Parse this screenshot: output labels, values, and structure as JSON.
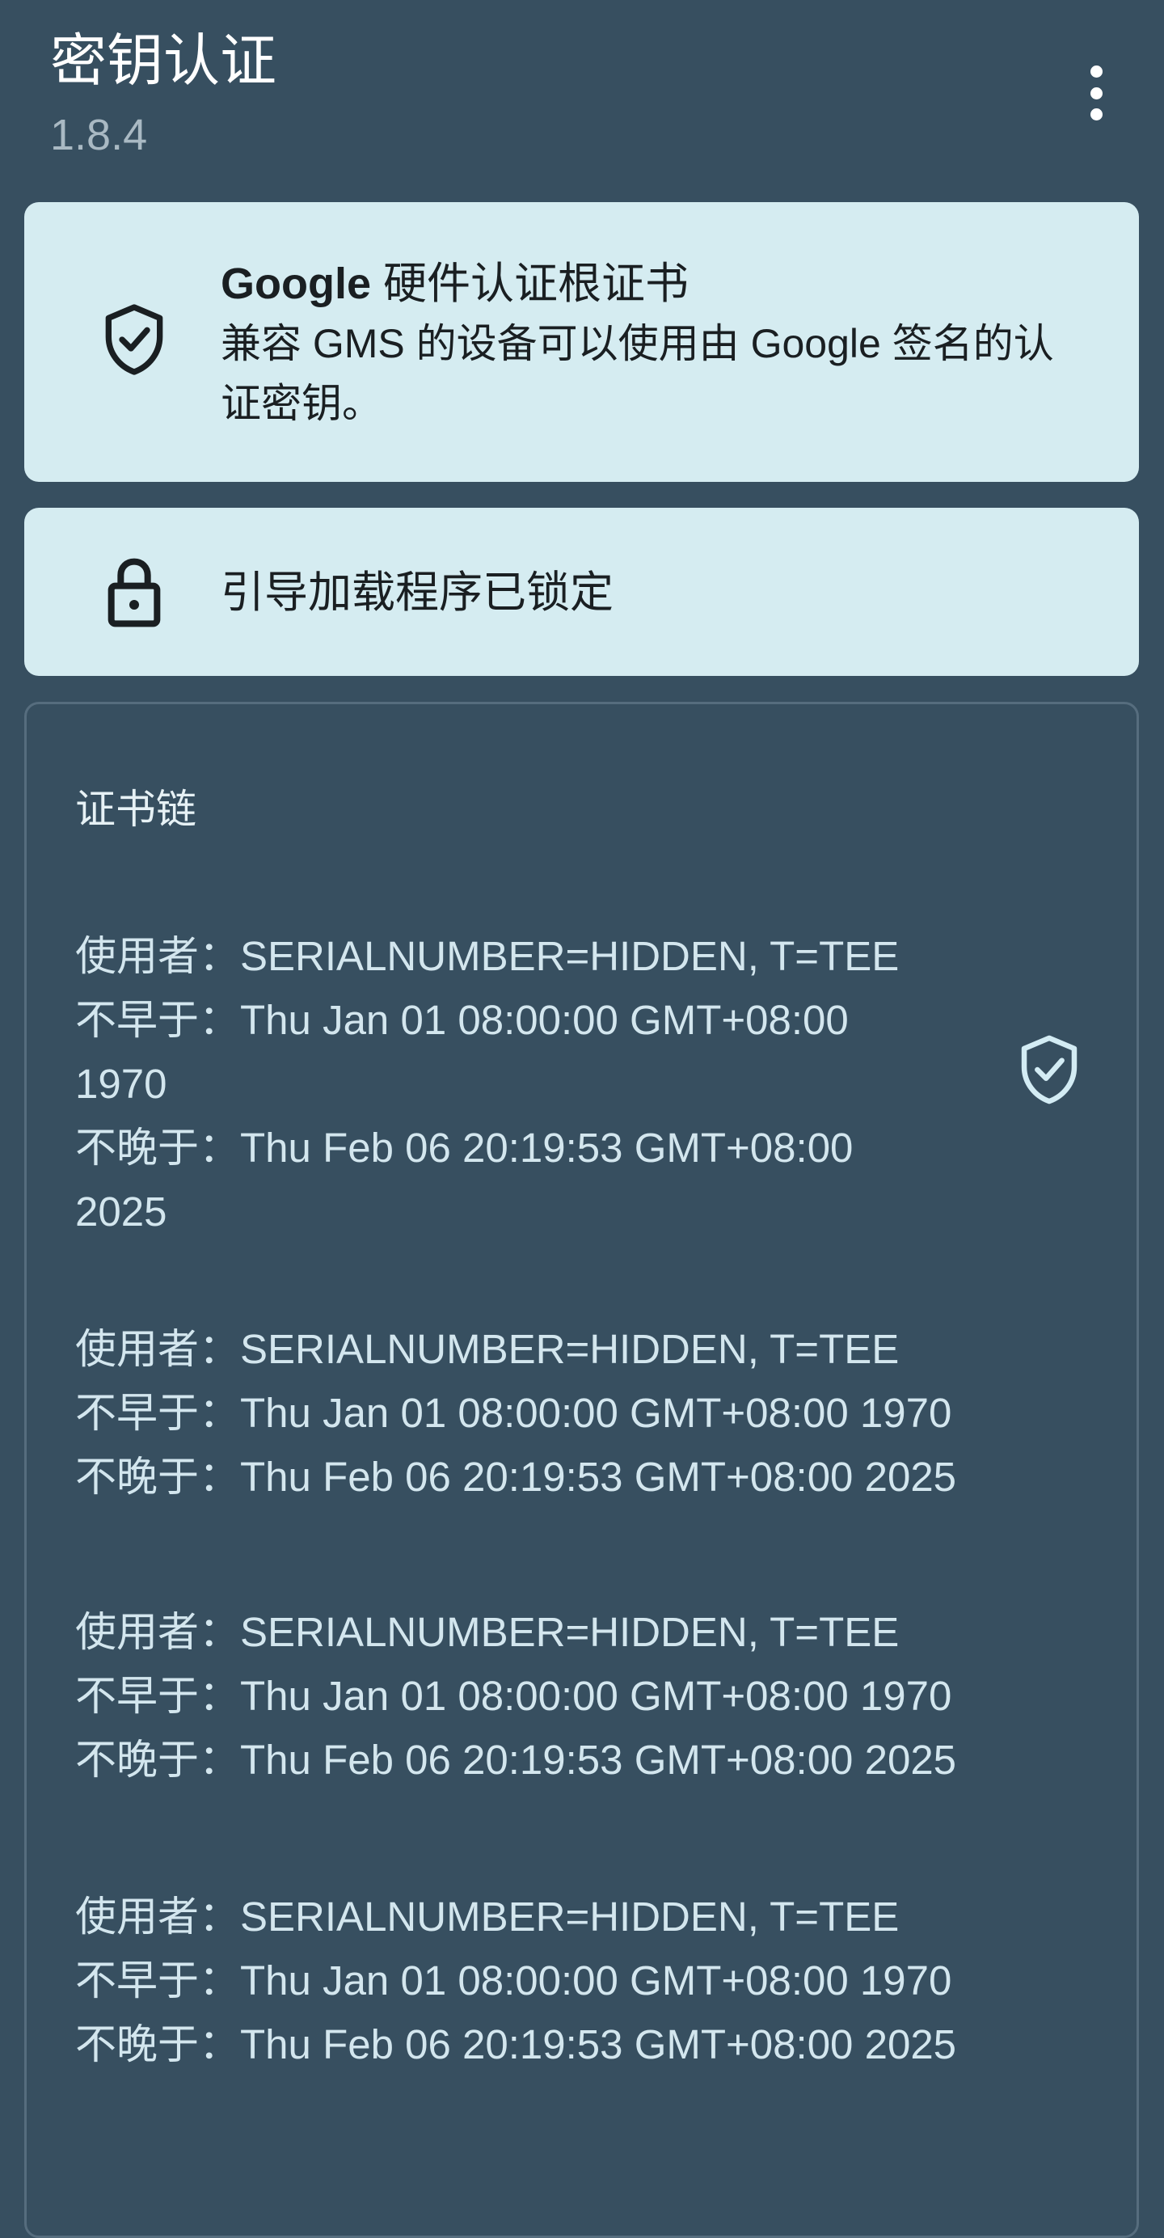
{
  "header": {
    "title": "密钥认证",
    "version": "1.8.4",
    "menu_icon": "more-vert-icon"
  },
  "root_card": {
    "brand": "Google",
    "title_rest": " 硬件认证根证书",
    "description": "兼容 GMS 的设备可以使用由 Google 签名的认证密钥。",
    "icon": "shield-check-icon"
  },
  "bootloader_card": {
    "text": "引导加载程序已锁定",
    "icon": "lock-icon"
  },
  "chain": {
    "title": "证书链",
    "entries": [
      {
        "subject_label": "使用者：",
        "subject": "SERIALNUMBER=HIDDEN, T=TEE",
        "not_before_label": "不早于：",
        "not_before": "Thu Jan 01 08:00:00 GMT+08:00 1970",
        "not_after_label": "不晚于：",
        "not_after": "Thu Feb 06 20:19:53 GMT+08:00 2025"
      },
      {
        "subject_label": "使用者：",
        "subject": "SERIALNUMBER=HIDDEN, T=TEE",
        "not_before_label": "不早于：",
        "not_before": "Thu Jan 01 08:00:00 GMT+08:00 1970",
        "not_after_label": "不晚于：",
        "not_after": "Thu Feb 06 20:19:53 GMT+08:00 2025"
      },
      {
        "subject_label": "使用者：",
        "subject": "SERIALNUMBER=HIDDEN, T=TEE",
        "not_before_label": "不早于：",
        "not_before": "Thu Jan 01 08:00:00 GMT+08:00 1970",
        "not_after_label": "不晚于：",
        "not_after": "Thu Feb 06 20:19:53 GMT+08:00 2025"
      },
      {
        "subject_label": "使用者：",
        "subject": "SERIALNUMBER=HIDDEN, T=TEE",
        "not_before_label": "不早于：",
        "not_before": "Thu Jan 01 08:00:00 GMT+08:00 1970",
        "not_after_label": "不晚于：",
        "not_after": "Thu Feb 06 20:19:53 GMT+08:00 2025"
      }
    ]
  },
  "colors": {
    "background": "#374f60",
    "card": "#d5ecf1",
    "text_light": "#d3e6ee"
  }
}
